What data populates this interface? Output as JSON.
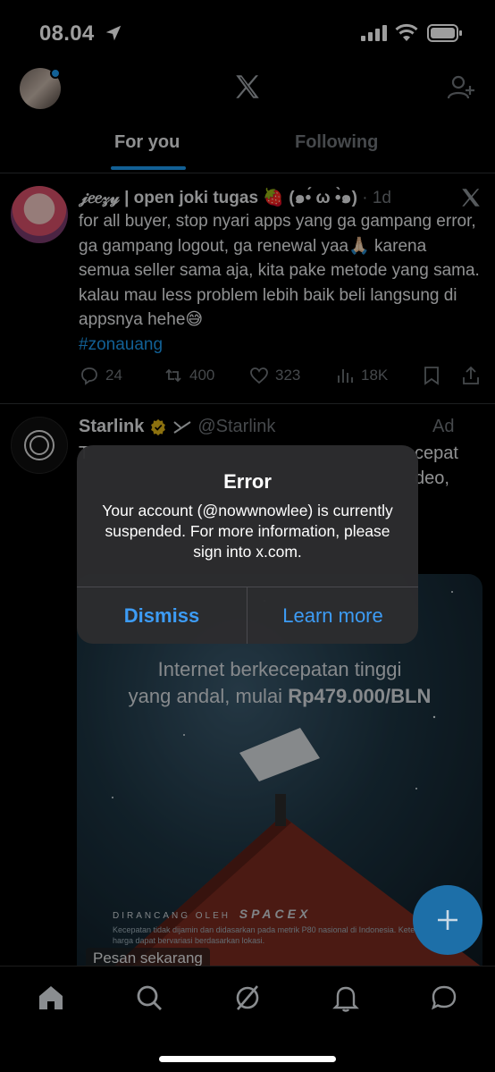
{
  "status_bar": {
    "time": "08.04"
  },
  "header": {
    "tabs": [
      {
        "label": "For you"
      },
      {
        "label": "Following"
      }
    ]
  },
  "tweet1": {
    "name": "𝒿𝑒𝑒𝓏𝓎 | open joki tugas 🍓 (๑•́ ω •̀๑)",
    "time": "· 1d",
    "text": "for all buyer, stop nyari apps yang ga gampang error, ga gampang logout, ga renewal yaa🙏🏻 karena semua seller sama aja, kita pake metode yang sama. kalau mau less problem lebih baik beli langsung di appsnya hehe😅",
    "hashtag": "#zonauang",
    "stats": {
      "replies": "24",
      "reposts": "400",
      "likes": "323",
      "views": "18K"
    }
  },
  "tweet2": {
    "name": "Starlink",
    "handle": "@Starlink",
    "ad_label": "Ad",
    "text_fragment_a": "T",
    "text_fragment_b": "cepat",
    "text_fragment_c": "deo,",
    "card": {
      "headline_line1": "Internet berkecepatan tinggi",
      "headline_line2": "yang andal, mulai ",
      "price": "Rp479.000/BLN",
      "brand_prefix": "DIRANCANG OLEH",
      "brand_logo": "SPACEX",
      "disclaimer": "Kecepatan tidak dijamin dan didasarkan pada metrik P80 nasional di Indonesia. Ketersediaan dan harga dapat bervariasi berdasarkan lokasi.",
      "cta": "Pesan sekarang"
    }
  },
  "alert": {
    "title": "Error",
    "message": "Your account (@nowwnowlee) is currently suspended. For more information, please sign into x.com.",
    "dismiss_label": "Dismiss",
    "learn_more_label": "Learn more"
  },
  "colors": {
    "accent": "#1d9bf0",
    "alert_button": "#3d9cf5",
    "background": "#000000"
  }
}
